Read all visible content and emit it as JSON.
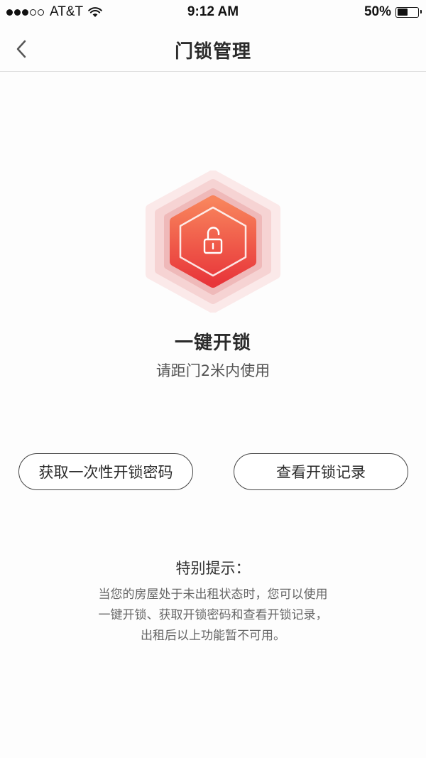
{
  "status_bar": {
    "carrier": "AT&T",
    "time": "9:12 AM",
    "battery": "50%",
    "battery_level": 0.5,
    "signal_bars_filled": 3,
    "signal_bars_total": 5
  },
  "nav": {
    "title": "门锁管理",
    "back_icon": "chevron-left-icon"
  },
  "unlock": {
    "icon": "unlocked-padlock-icon",
    "title": "一键开锁",
    "hint": "请距门2米内使用",
    "colors": {
      "gradient_top": "#f8845c",
      "gradient_bottom": "#e8363a",
      "halo": "#f3c6c6"
    }
  },
  "actions": {
    "one_time_password_label": "获取一次性开锁密码",
    "records_label": "查看开锁记录"
  },
  "notice": {
    "title": "特别提示：",
    "lines": [
      "当您的房屋处于未出租状态时，您可以使用",
      "一键开锁、获取开锁密码和查看开锁记录，",
      "出租后以上功能暂不可用。"
    ]
  }
}
